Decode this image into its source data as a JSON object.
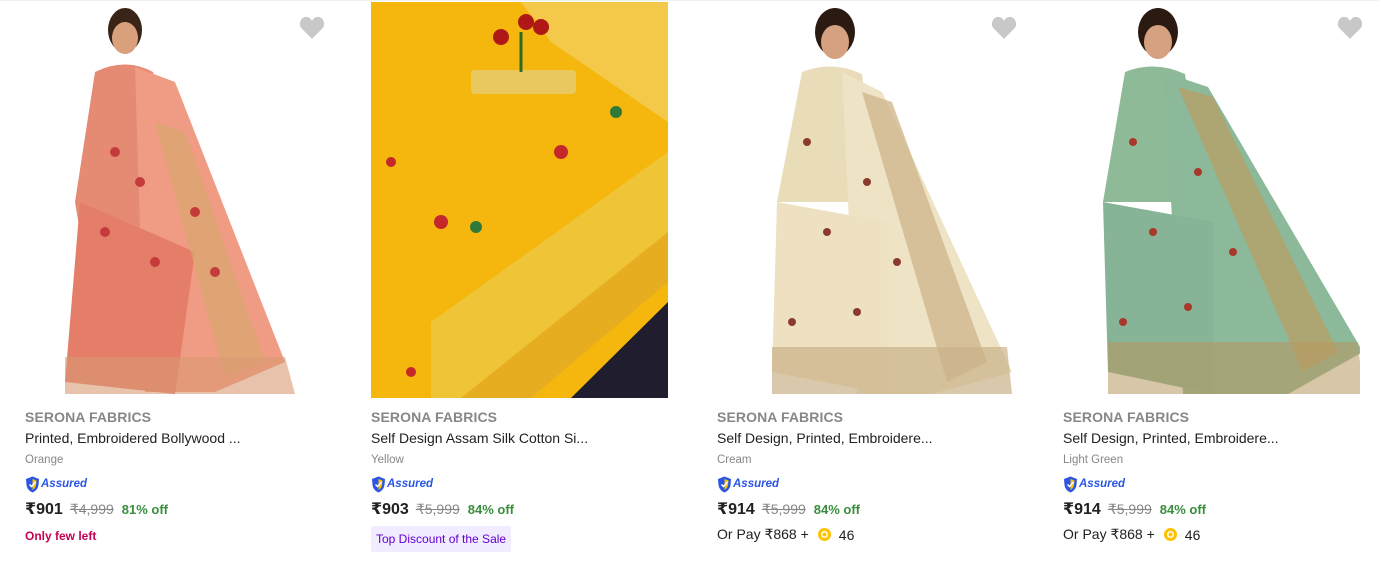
{
  "products": [
    {
      "brand": "SERONA FABRICS",
      "title": "Printed, Embroidered Bollywood ...",
      "color": "Orange",
      "price": "₹901",
      "mrp": "₹4,999",
      "discount": "81% off",
      "badge_text": "Only few left",
      "image_theme": "#e98a78"
    },
    {
      "brand": "SERONA FABRICS",
      "title": "Self Design Assam Silk Cotton Si...",
      "color": "Yellow",
      "price": "₹903",
      "mrp": "₹5,999",
      "discount": "84% off",
      "badge_text": "Top Discount of the Sale",
      "image_theme": "#f5b70e"
    },
    {
      "brand": "SERONA FABRICS",
      "title": "Self Design, Printed, Embroidere...",
      "color": "Cream",
      "price": "₹914",
      "mrp": "₹5,999",
      "discount": "84% off",
      "pay_text": "Or Pay ₹868 +",
      "coins": "46",
      "image_theme": "#efe3c6"
    },
    {
      "brand": "SERONA FABRICS",
      "title": "Self Design, Printed, Embroidere...",
      "color": "Light Green",
      "price": "₹914",
      "mrp": "₹5,999",
      "discount": "84% off",
      "pay_text": "Or Pay ₹868 +",
      "coins": "46",
      "image_theme": "#8cb99a"
    }
  ],
  "assured_label": "Assured",
  "colors": {
    "discount": "#388e3c",
    "few_left": "#c70055",
    "sale_tag": "#6500ce",
    "assured": "#2a55e5",
    "heart": "#c8c8c8"
  }
}
